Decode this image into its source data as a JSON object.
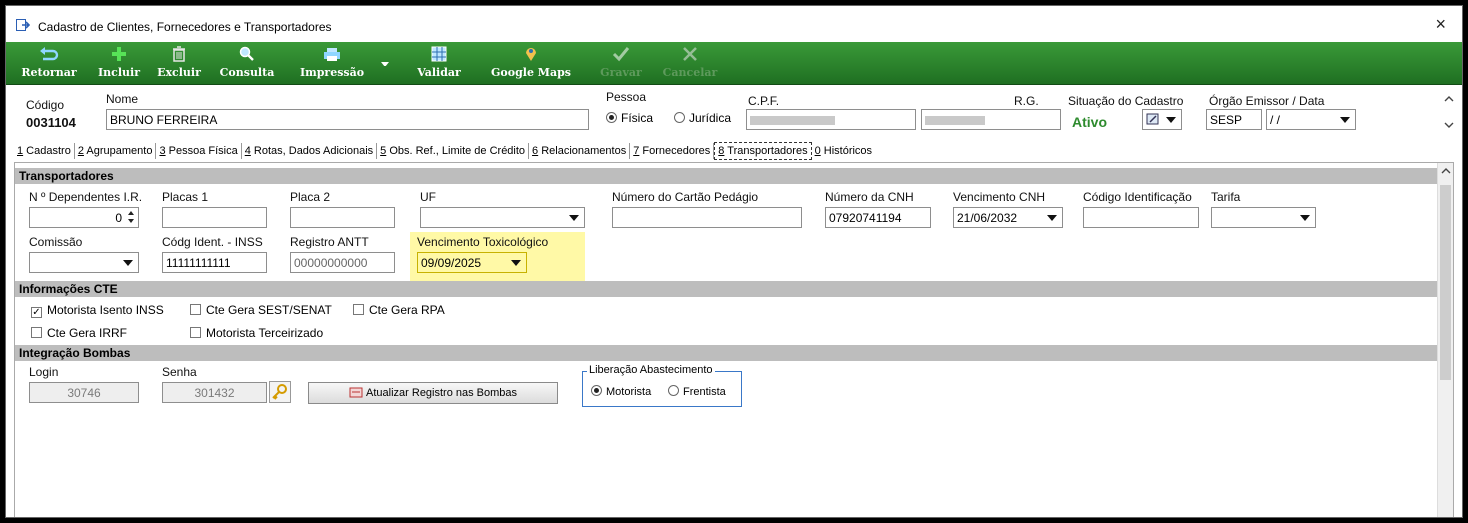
{
  "window": {
    "title": "Cadastro de Clientes, Fornecedores e Transportadores",
    "close": "×"
  },
  "toolbar": {
    "buttons": [
      {
        "label": "Retornar",
        "icon": "return-icon"
      },
      {
        "label": "Incluir",
        "icon": "plus-icon"
      },
      {
        "label": "Excluir",
        "icon": "trash-icon"
      },
      {
        "label": "Consulta",
        "icon": "search-icon"
      },
      {
        "label": "Impressão",
        "icon": "printer-icon"
      },
      {
        "label": "Validar",
        "icon": "grid-icon"
      },
      {
        "label": "Google Maps",
        "icon": "map-pin-icon"
      },
      {
        "label": "Gravar",
        "icon": "check-icon",
        "disabled": true
      },
      {
        "label": "Cancelar",
        "icon": "cancel-icon",
        "disabled": true
      }
    ]
  },
  "header": {
    "codigo_label": "Código",
    "codigo_value": "0031104",
    "nome_label": "Nome",
    "nome_value": "BRUNO FERREIRA",
    "pessoa_label": "Pessoa",
    "fisica_label": "Física",
    "juridica_label": "Jurídica",
    "cpf_label": "C.P.F.",
    "rg_label": "R.G.",
    "situacao_label": "Situação do Cadastro",
    "situacao_value": "Ativo",
    "orgao_label": "Órgão Emissor / Data",
    "orgao_value": "SESP",
    "orgao_date": " / /"
  },
  "tabs": [
    {
      "key": "1",
      "label": " Cadastro"
    },
    {
      "key": "2",
      "label": " Agrupamento"
    },
    {
      "key": "3",
      "label": " Pessoa Física"
    },
    {
      "key": "4",
      "label": " Rotas, Dados Adicionais"
    },
    {
      "key": "5",
      "label": " Obs. Ref., Limite de Crédito"
    },
    {
      "key": "6",
      "label": " Relacionamentos"
    },
    {
      "key": "7",
      "label": " Fornecedores"
    },
    {
      "key": "8",
      "label": " Transportadores",
      "active": true
    },
    {
      "key": "0",
      "label": " Históricos"
    }
  ],
  "transportadores": {
    "section_title": "Transportadores",
    "dependentes_label": "N º Dependentes I.R.",
    "dependentes_value": "0",
    "placas1_label": "Placas 1",
    "placa2_label": "Placa 2",
    "uf_label": "UF",
    "cartao_label": "Número do Cartão Pedágio",
    "cnh_label": "Número da CNH",
    "cnh_value": "07920741194",
    "venc_cnh_label": "Vencimento CNH",
    "venc_cnh_value": "21/06/2032",
    "cod_ident_label": "Código Identificação",
    "tarifa_label": "Tarifa",
    "comissao_label": "Comissão",
    "inss_label": "Códg Ident. - INSS",
    "inss_value": "11111111111",
    "antt_label": "Registro ANTT",
    "antt_value": "00000000000",
    "toxico_label": "Vencimento Toxicológico",
    "toxico_value": "09/09/2025"
  },
  "cte": {
    "section_title": "Informações CTE",
    "motorista_isento": "Motorista Isento INSS",
    "sest_senat": "Cte Gera SEST/SENAT",
    "rpa": "Cte Gera RPA",
    "irrf": "Cte Gera IRRF",
    "terceirizado": "Motorista Terceirizado"
  },
  "bombas": {
    "section_title": "Integração Bombas",
    "login_label": "Login",
    "login_value": "30746",
    "senha_label": "Senha",
    "senha_value": "301432",
    "atualizar_label": "Atualizar Registro nas Bombas",
    "liberacao_label": "Liberação Abastecimento",
    "motorista_label": "Motorista",
    "frentista_label": "Frentista"
  },
  "colors": {
    "toolbar_green": "#2e8a2e",
    "status_green": "#2e8b2e",
    "highlight_yellow": "#fff9a6"
  }
}
